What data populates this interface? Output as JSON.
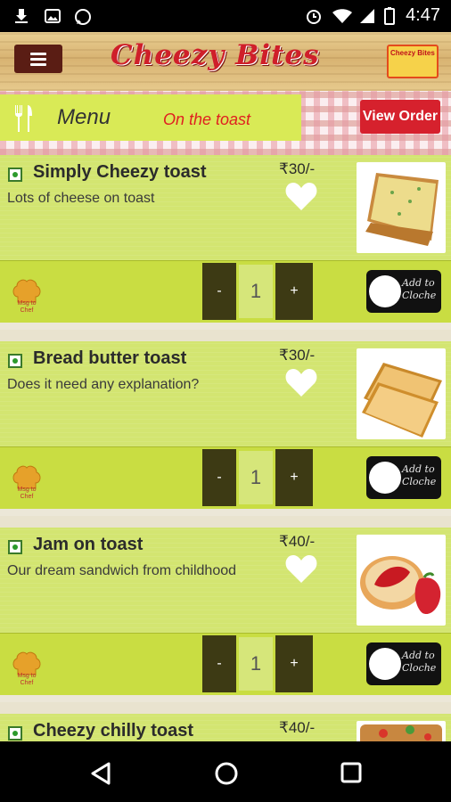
{
  "status_bar": {
    "time": "4:47"
  },
  "header": {
    "brand": "Cheezy Bites",
    "logo_text": "Cheezy Bites"
  },
  "subheader": {
    "menu_label": "Menu",
    "category": "On the toast",
    "view_order": "View Order"
  },
  "items": [
    {
      "name": "Simply Cheezy toast",
      "description": "Lots of cheese on toast",
      "price": "₹30/-",
      "quantity": "1",
      "veg": true,
      "minus": "-",
      "plus": "+",
      "msg_label": "Msg to Chef",
      "add_label": "Add to Cloche",
      "image": "toast-cheese-icon"
    },
    {
      "name": "Bread butter toast",
      "description": "Does it need any explanation?",
      "price": "₹30/-",
      "quantity": "1",
      "veg": true,
      "minus": "-",
      "plus": "+",
      "msg_label": "Msg to Chef",
      "add_label": "Add to Cloche",
      "image": "bread-toast-icon"
    },
    {
      "name": "Jam on toast",
      "description": "Our dream sandwich from childhood",
      "price": "₹40/-",
      "quantity": "1",
      "veg": true,
      "minus": "-",
      "plus": "+",
      "msg_label": "Msg to Chef",
      "add_label": "Add to Cloche",
      "image": "jam-toast-icon"
    },
    {
      "name": "Cheezy chilly toast",
      "price": "₹40/-",
      "veg": true,
      "image": "chilly-toast-icon"
    }
  ],
  "colors": {
    "accent_red": "#d6212d",
    "item_green": "#d3e571",
    "bar_green": "#c9dd42",
    "dark_olive": "#3d3a14"
  }
}
